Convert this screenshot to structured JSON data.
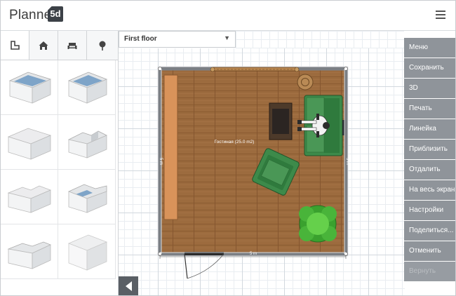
{
  "app": {
    "logo_text": "Planner",
    "logo_badge": "5d"
  },
  "left_panel": {
    "tabs": [
      {
        "name": "room-shapes",
        "icon": "room-shape-icon",
        "active": true
      },
      {
        "name": "home",
        "icon": "home-icon",
        "active": false
      },
      {
        "name": "furniture",
        "icon": "sofa-icon",
        "active": false
      },
      {
        "name": "outdoor",
        "icon": "tree-icon",
        "active": false
      }
    ],
    "rooms": [
      "rectangle-room",
      "square-room",
      "l-shaped-room",
      "notched-room",
      "t-shaped-room",
      "corner-room",
      "l-wall-room",
      "solid-block"
    ]
  },
  "floor_select": {
    "value": "First floor"
  },
  "plan": {
    "room_label": "Гостиная (25.0 m2)",
    "dim_bottom": "5 m",
    "dim_left": "5 m",
    "dim_right": "5 m",
    "floor_color": "#9c6b3e",
    "wall_color": "#7b7f84"
  },
  "menu": {
    "items": [
      {
        "label": "Меню",
        "enabled": true
      },
      {
        "label": "Сохранить",
        "enabled": true
      },
      {
        "label": "3D",
        "enabled": true
      },
      {
        "label": "Печать",
        "enabled": true
      },
      {
        "label": "Линейка",
        "enabled": true
      },
      {
        "label": "Приблизить",
        "enabled": true
      },
      {
        "label": "Отдалить",
        "enabled": true
      },
      {
        "label": "На весь экран",
        "enabled": true
      },
      {
        "label": "Настройки",
        "enabled": true
      },
      {
        "label": "Поделиться...",
        "enabled": true
      },
      {
        "label": "Отменить",
        "enabled": true
      },
      {
        "label": "Вернуть",
        "enabled": false
      }
    ]
  },
  "colors": {
    "accent": "#8f949a",
    "sofa": "#3d8a4a",
    "plant": "#4fbb3a"
  }
}
